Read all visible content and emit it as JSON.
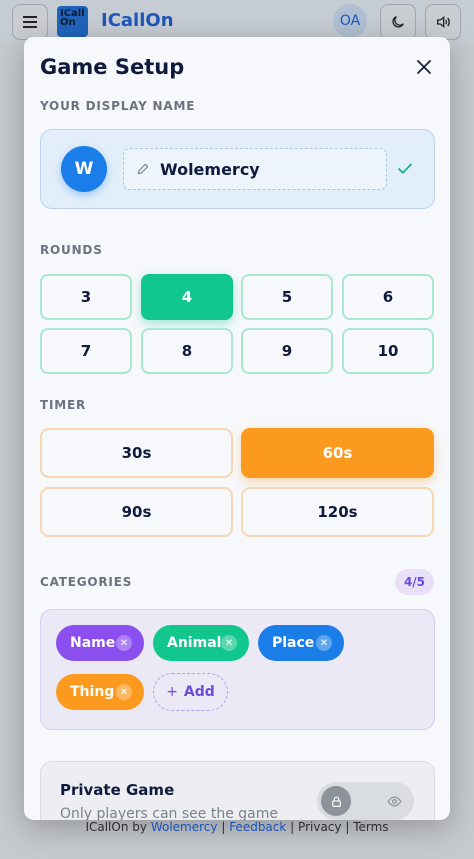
{
  "appbar": {
    "logo_mark": "ICall On",
    "title": "ICallOn",
    "avatar_initials": "OA"
  },
  "modal": {
    "title": "Game Setup",
    "display_name": {
      "label": "YOUR DISPLAY NAME",
      "avatar_letter": "W",
      "value": "Wolemercy"
    },
    "rounds": {
      "label": "ROUNDS",
      "options": [
        "3",
        "4",
        "5",
        "6",
        "7",
        "8",
        "9",
        "10"
      ],
      "selected": "4"
    },
    "timer": {
      "label": "TIMER",
      "options": [
        "30s",
        "60s",
        "90s",
        "120s"
      ],
      "selected": "60s"
    },
    "categories": {
      "label": "CATEGORIES",
      "count": "4/5",
      "items": [
        {
          "label": "Name",
          "color": "#8b4ff0"
        },
        {
          "label": "Animal",
          "color": "#12c78e"
        },
        {
          "label": "Place",
          "color": "#1a7de8"
        },
        {
          "label": "Thing",
          "color": "#fb9a1e"
        }
      ],
      "add_label": "Add"
    },
    "private": {
      "title": "Private Game",
      "subtitle": "Only players can see the game"
    }
  },
  "footer": {
    "brand": "ICallOn by",
    "author": "Wolemercy",
    "sep": "|",
    "feedback": "Feedback",
    "privacy": "Privacy",
    "terms": "Terms"
  },
  "colors": {
    "accent_blue": "#1a7de8",
    "rounds_green": "#12c78e",
    "timer_orange": "#fb9a1e",
    "category_purple": "#6f4bd9"
  }
}
